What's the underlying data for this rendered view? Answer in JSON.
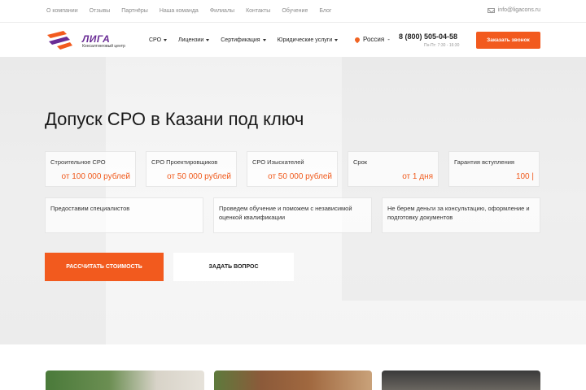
{
  "topbar": {
    "links": [
      "О компании",
      "Отзывы",
      "Партнёры",
      "Наша команда",
      "Филиалы",
      "Контакты",
      "Обучение",
      "Блог"
    ],
    "email": "info@ligacons.ru"
  },
  "header": {
    "logo_title": "ЛИГА",
    "logo_subtitle": "Консалтинговый центр",
    "nav": [
      "СРО",
      "Лицензии",
      "Сертификация",
      "Юридические услуги"
    ],
    "region": "Россия",
    "phone": "8 (800) 505-04-58",
    "hours": "Пн-Пт: 7:30 - 16:30",
    "call_button": "Заказать звонок"
  },
  "hero": {
    "title": "Допуск СРО в Казани под ключ",
    "cards": [
      {
        "label": "Строительное СРО",
        "value": "от 100 000 рублей"
      },
      {
        "label": "СРО Проектировщиков",
        "value": "от 50 000 рублей"
      },
      {
        "label": "СРО Изыскателей",
        "value": "от 50 000 рублей"
      },
      {
        "label": "Срок",
        "value": "от 1 дня"
      },
      {
        "label": "Гарантия вступления",
        "value": "100 |"
      }
    ],
    "features": [
      "Предоставим специалистов",
      "Проведем обучение и поможем с независимой оценкой квалификации",
      "Не берем деньги за консультацию, оформление и подготовку документов"
    ],
    "calc_button": "РАССЧИТАТЬ СТОИМОСТЬ",
    "ask_button": "ЗАДАТЬ ВОПРОС"
  },
  "colors": {
    "accent": "#f25a1e",
    "brand": "#6a2c95"
  },
  "icons": [
    "mail-icon",
    "logo-icon",
    "chevron-down-icon",
    "location-pin-icon"
  ]
}
